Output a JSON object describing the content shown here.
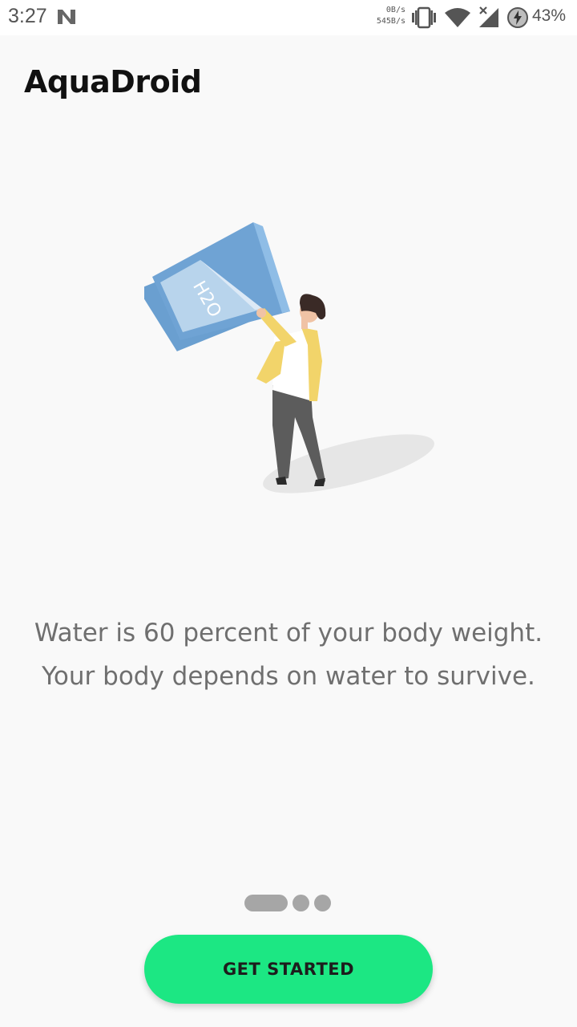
{
  "status_bar": {
    "time": "3:27",
    "net_down": "0B/s",
    "net_up": "545B/s",
    "battery": "43%",
    "icons": [
      "n-logo-icon",
      "vibrate-icon",
      "wifi-icon",
      "signal-icon",
      "battery-charging-icon"
    ]
  },
  "app": {
    "title": "AquaDroid"
  },
  "onboarding": {
    "illustration_label": "H2O",
    "description": "Water is 60 percent of your body weight. Your body depends on water to survive.",
    "pages": 3,
    "current_page": 1
  },
  "cta": {
    "label": "GET STARTED"
  },
  "colors": {
    "accent": "#1ce783",
    "background": "#f9f9f9",
    "text_muted": "#6f6f6f",
    "pager": "#a6a6a6"
  }
}
